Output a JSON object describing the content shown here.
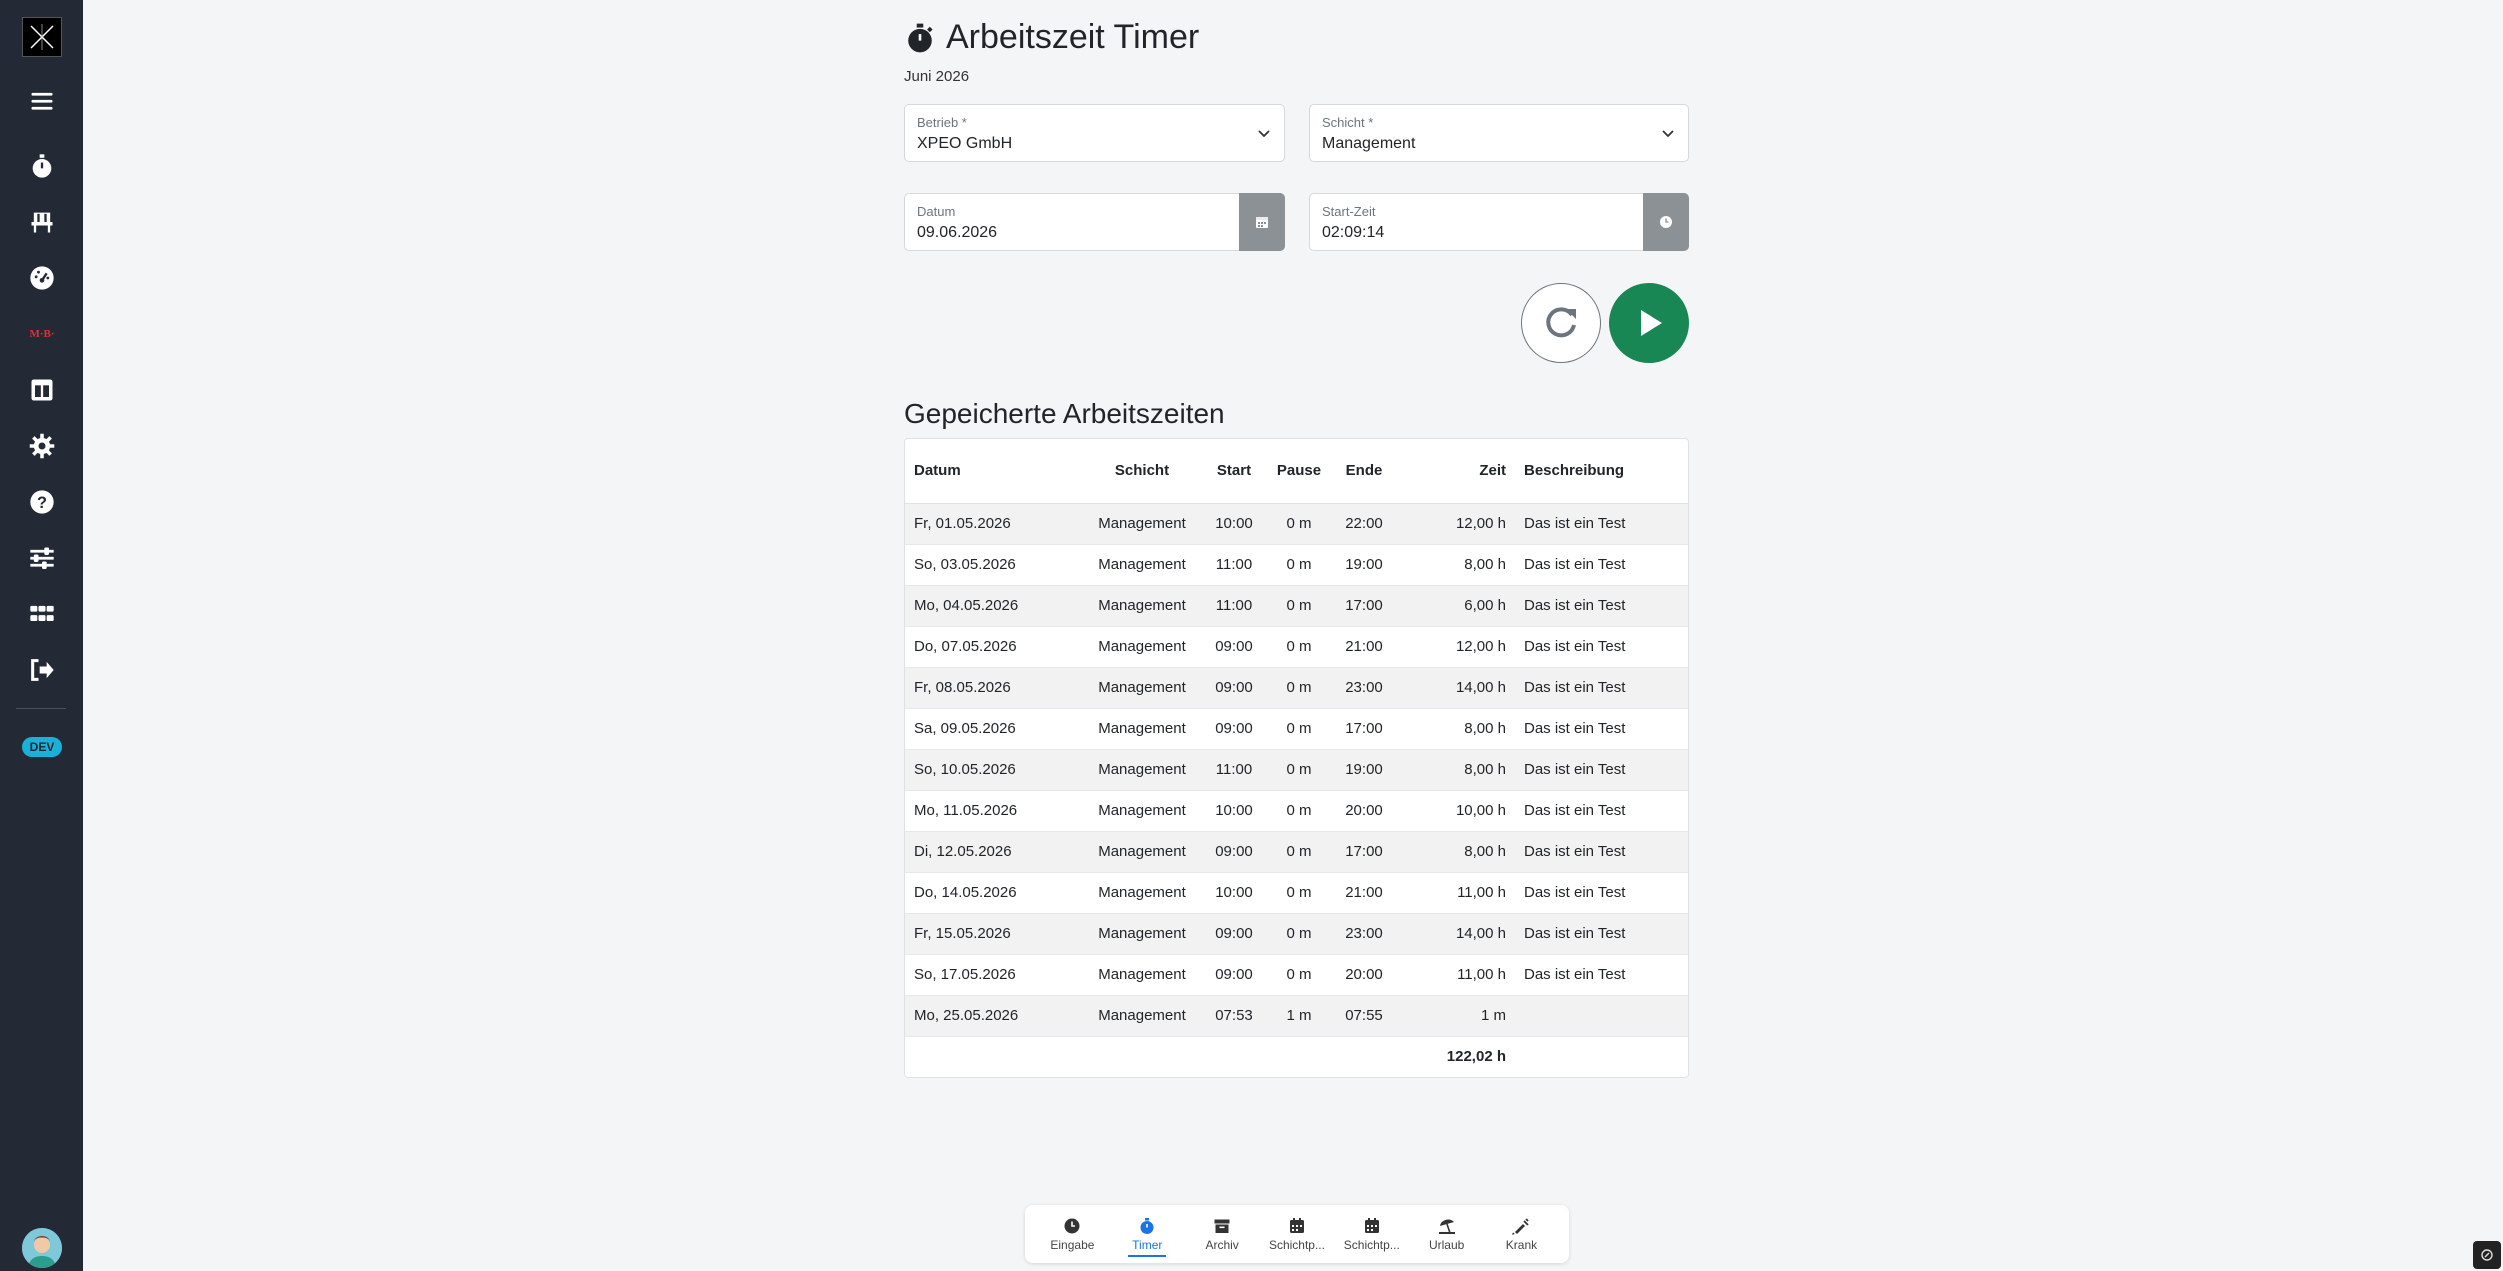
{
  "app": {
    "title": "Arbeitszeit Timer",
    "month": "Juni 2026"
  },
  "sidebar": {
    "items": [
      {
        "name": "menu-icon"
      },
      {
        "name": "stopwatch-icon"
      },
      {
        "name": "chair-icon"
      },
      {
        "name": "dashboard-icon"
      },
      {
        "name": "meb-logo-icon",
        "text": "M·B·"
      },
      {
        "name": "columns-icon"
      },
      {
        "name": "gear-icon"
      },
      {
        "name": "help-icon"
      },
      {
        "name": "sliders-icon"
      },
      {
        "name": "apps-grid-icon"
      },
      {
        "name": "logout-icon"
      }
    ],
    "badge": "DEV"
  },
  "form": {
    "betrieb": {
      "label": "Betrieb *",
      "value": "XPEO GmbH"
    },
    "schicht": {
      "label": "Schicht *",
      "value": "Management"
    },
    "datum": {
      "label": "Datum",
      "value": "09.06.2026"
    },
    "startzeit": {
      "label": "Start-Zeit",
      "value": "02:09:14"
    }
  },
  "table": {
    "title": "Gepeicherte Arbeitszeiten",
    "columns": [
      "Datum",
      "Schicht",
      "Start",
      "Pause",
      "Ende",
      "Zeit",
      "Beschreibung"
    ],
    "rows": [
      [
        "Fr, 01.05.2026",
        "Management",
        "10:00",
        "0 m",
        "22:00",
        "12,00 h",
        "Das ist ein Test"
      ],
      [
        "So, 03.05.2026",
        "Management",
        "11:00",
        "0 m",
        "19:00",
        "8,00 h",
        "Das ist ein Test"
      ],
      [
        "Mo, 04.05.2026",
        "Management",
        "11:00",
        "0 m",
        "17:00",
        "6,00 h",
        "Das ist ein Test"
      ],
      [
        "Do, 07.05.2026",
        "Management",
        "09:00",
        "0 m",
        "21:00",
        "12,00 h",
        "Das ist ein Test"
      ],
      [
        "Fr, 08.05.2026",
        "Management",
        "09:00",
        "0 m",
        "23:00",
        "14,00 h",
        "Das ist ein Test"
      ],
      [
        "Sa, 09.05.2026",
        "Management",
        "09:00",
        "0 m",
        "17:00",
        "8,00 h",
        "Das ist ein Test"
      ],
      [
        "So, 10.05.2026",
        "Management",
        "11:00",
        "0 m",
        "19:00",
        "8,00 h",
        "Das ist ein Test"
      ],
      [
        "Mo, 11.05.2026",
        "Management",
        "10:00",
        "0 m",
        "20:00",
        "10,00 h",
        "Das ist ein Test"
      ],
      [
        "Di, 12.05.2026",
        "Management",
        "09:00",
        "0 m",
        "17:00",
        "8,00 h",
        "Das ist ein Test"
      ],
      [
        "Do, 14.05.2026",
        "Management",
        "10:00",
        "0 m",
        "21:00",
        "11,00 h",
        "Das ist ein Test"
      ],
      [
        "Fr, 15.05.2026",
        "Management",
        "09:00",
        "0 m",
        "23:00",
        "14,00 h",
        "Das ist ein Test"
      ],
      [
        "So, 17.05.2026",
        "Management",
        "09:00",
        "0 m",
        "20:00",
        "11,00 h",
        "Das ist ein Test"
      ],
      [
        "Mo, 25.05.2026",
        "Management",
        "07:53",
        "1 m",
        "07:55",
        "1 m",
        ""
      ]
    ],
    "total": "122,02 h"
  },
  "bottom_nav": [
    {
      "label": "Eingabe",
      "icon": "clock-icon",
      "active": false
    },
    {
      "label": "Timer",
      "icon": "stopwatch-icon",
      "active": true
    },
    {
      "label": "Archiv",
      "icon": "archive-icon",
      "active": false
    },
    {
      "label": "Schichtp...",
      "icon": "calendar-icon",
      "active": false
    },
    {
      "label": "Schichtp...",
      "icon": "calendar-icon",
      "active": false
    },
    {
      "label": "Urlaub",
      "icon": "umbrella-beach-icon",
      "active": false
    },
    {
      "label": "Krank",
      "icon": "syringe-icon",
      "active": false
    }
  ],
  "colors": {
    "sidebar": "#232a35",
    "play": "#198754",
    "active": "#1a73e8",
    "badge": "#1ab0d8"
  }
}
